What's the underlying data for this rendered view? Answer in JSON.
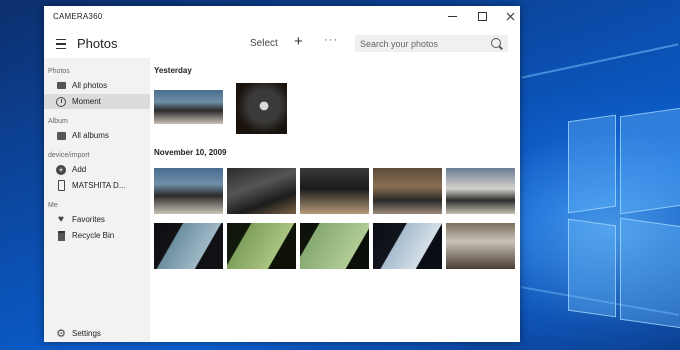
{
  "window": {
    "app_title": "CAMERA360",
    "minimize_icon": "minimize-icon",
    "maximize_icon": "maximize-icon",
    "close_icon": "close-icon"
  },
  "header": {
    "title": "Photos",
    "select_label": "Select",
    "add_symbol": "+",
    "more_symbol": "···",
    "search_placeholder": "Search your photos"
  },
  "sidebar": {
    "groups": [
      {
        "label": "Photos",
        "items": [
          {
            "label": "All photos",
            "icon": "photo-icon",
            "selected": false
          },
          {
            "label": "Moment",
            "icon": "clock-icon",
            "selected": true
          }
        ]
      },
      {
        "label": "Album",
        "items": [
          {
            "label": "All albums",
            "icon": "album-icon",
            "selected": false
          }
        ]
      },
      {
        "label": "device/import",
        "items": [
          {
            "label": "Add",
            "icon": "add-circle-icon",
            "selected": false
          },
          {
            "label": "MATSHITA D...",
            "icon": "phone-icon",
            "selected": false
          }
        ]
      },
      {
        "label": "Me",
        "items": [
          {
            "label": "Favorites",
            "icon": "heart-icon",
            "selected": false
          },
          {
            "label": "Recycle Bin",
            "icon": "trash-icon",
            "selected": false
          }
        ]
      }
    ],
    "settings_label": "Settings"
  },
  "content": {
    "sections": [
      {
        "title": "Yesterday",
        "photo_count": 2
      },
      {
        "title": "November 10, 2009",
        "photo_count": 10
      }
    ]
  }
}
